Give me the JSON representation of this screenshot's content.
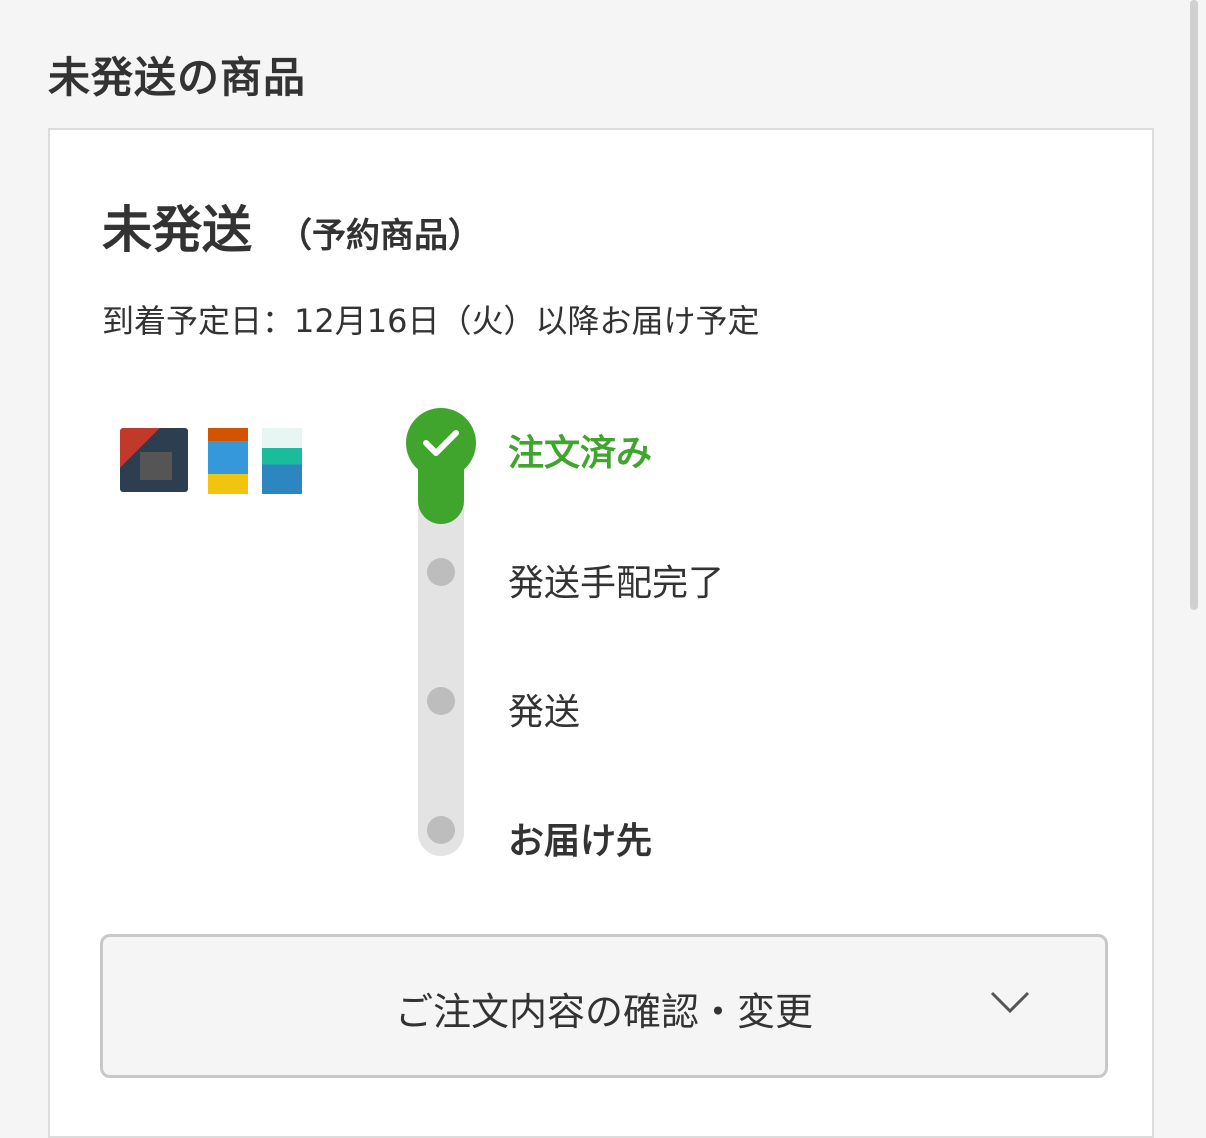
{
  "section_title": "未発送の商品",
  "card": {
    "status": "未発送",
    "status_note": "（予約商品）",
    "arrival": "到着予定日：12月16日（火）以降お届け予定"
  },
  "steps": [
    {
      "label": "注文済み",
      "state": "done"
    },
    {
      "label": "発送手配完了",
      "state": "pending"
    },
    {
      "label": "発送",
      "state": "pending"
    },
    {
      "label": "お届け先",
      "state": "pending"
    }
  ],
  "order_button": {
    "label": "ご注文内容の確認・変更",
    "icon": "chevron-down-icon"
  },
  "colors": {
    "accent": "#3fa52d",
    "inactive": "#bdbdbd",
    "track": "#e3e3e3"
  }
}
